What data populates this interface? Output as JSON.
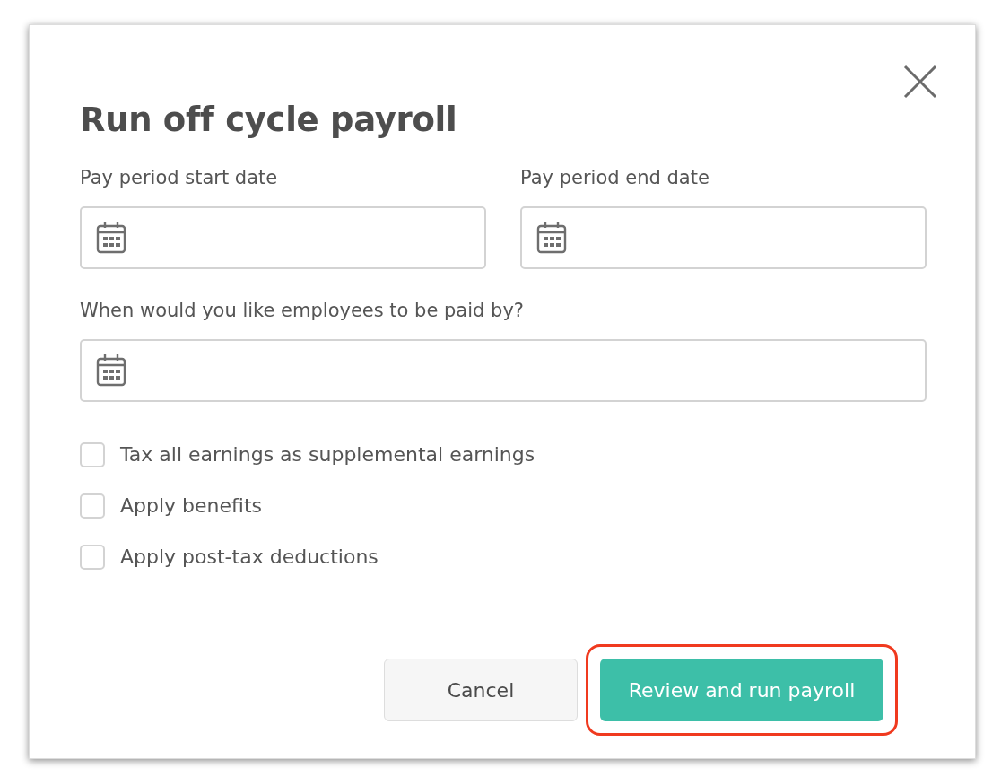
{
  "dialog": {
    "title": "Run off cycle payroll"
  },
  "date_fields": [
    {
      "label": "Pay period start date",
      "kind": "half"
    },
    {
      "label": "Pay period end date",
      "kind": "half"
    },
    {
      "label": "When would you like employees to be paid by?",
      "kind": "full"
    }
  ],
  "checkboxes": [
    {
      "label": "Tax all earnings as supplemental earnings",
      "checked": false
    },
    {
      "label": "Apply benefits",
      "checked": false
    },
    {
      "label": "Apply post-tax deductions",
      "checked": false
    }
  ],
  "buttons": [
    {
      "label": "Cancel",
      "kind": "secondary",
      "highlighted": false
    },
    {
      "label": "Review and run payroll",
      "kind": "primary",
      "highlighted": true
    }
  ]
}
